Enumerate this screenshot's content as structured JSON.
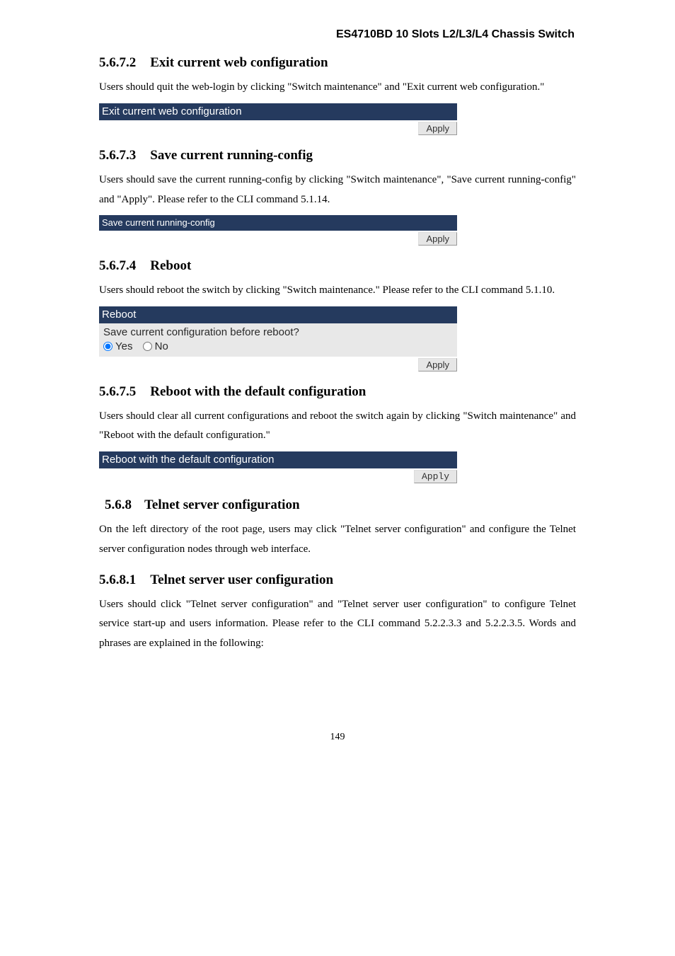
{
  "header": {
    "product_title": "ES4710BD 10 Slots L2/L3/L4 Chassis Switch"
  },
  "s1": {
    "num": "5.6.7.2",
    "title": "Exit current web configuration",
    "body": "Users should quit the web-login by clicking \"Switch maintenance\" and \"Exit current web configuration.\"",
    "bar_label": "Exit current web configuration",
    "apply_label": "Apply"
  },
  "s2": {
    "num": "5.6.7.3",
    "title": "Save current running-config",
    "body": "Users should save the current running-config by clicking \"Switch maintenance\", \"Save current running-config\" and \"Apply\". Please refer to the CLI command 5.1.14.",
    "bar_label": "Save current running-config",
    "apply_label": "Apply"
  },
  "s3": {
    "num": "5.6.7.4",
    "title": "Reboot",
    "body": "Users should reboot the switch by clicking \"Switch maintenance.\" Please refer to the CLI command 5.1.10.",
    "bar_label": "Reboot",
    "question": "Save current configuration before reboot?",
    "opt_yes": "Yes",
    "opt_no": "No",
    "apply_label": "Apply"
  },
  "s4": {
    "num": "5.6.7.5",
    "title": "Reboot with the default configuration",
    "body": "Users should clear all current configurations and reboot the switch again by clicking \"Switch maintenance\" and \"Reboot with the default configuration.\"",
    "bar_label": "Reboot with the default configuration",
    "apply_label": "Apply"
  },
  "s5": {
    "num": "5.6.8",
    "title": "Telnet server configuration",
    "body": "On the left directory of the root page, users may click \"Telnet server configuration\" and configure the Telnet server configuration nodes through web interface."
  },
  "s6": {
    "num": "5.6.8.1",
    "title": "Telnet server user configuration",
    "body": "Users should click \"Telnet server configuration\" and \"Telnet server user configuration\" to configure Telnet service start-up and users information. Please refer to the CLI command 5.2.2.3.3 and 5.2.2.3.5. Words and phrases are explained in the following:"
  },
  "footer": {
    "page_number": "149"
  }
}
